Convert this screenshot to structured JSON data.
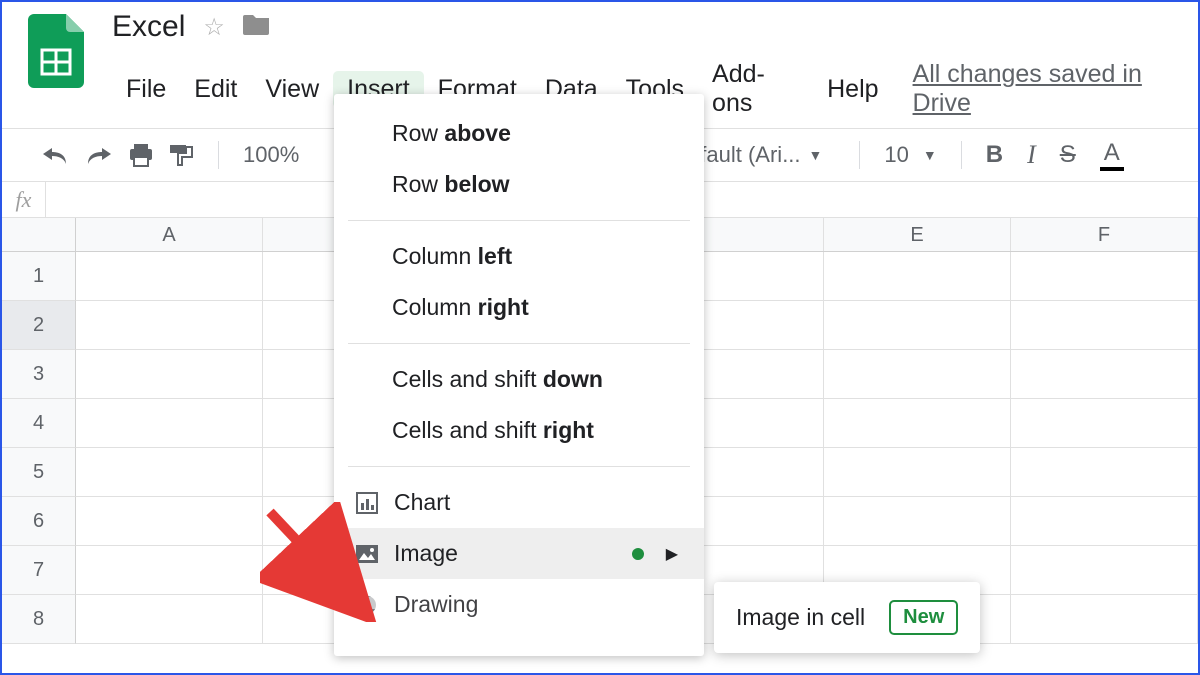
{
  "doc_title": "Excel",
  "menubar": [
    "File",
    "Edit",
    "View",
    "Insert",
    "Format",
    "Data",
    "Tools",
    "Add-ons",
    "Help"
  ],
  "active_menu_index": 3,
  "save_status": "All changes saved in Drive",
  "toolbar": {
    "zoom": "100%",
    "font_label": "fault (Ari...",
    "font_size": "10"
  },
  "columns": [
    "A",
    "",
    "",
    "",
    "E",
    "F"
  ],
  "row_count": 8,
  "selected_row": 2,
  "dropdown": {
    "group1": [
      {
        "prefix": "Row ",
        "bold": "above"
      },
      {
        "prefix": "Row ",
        "bold": "below"
      }
    ],
    "group2": [
      {
        "prefix": "Column ",
        "bold": "left"
      },
      {
        "prefix": "Column ",
        "bold": "right"
      }
    ],
    "group3": [
      {
        "prefix": "Cells and shift ",
        "bold": "down"
      },
      {
        "prefix": "Cells and shift ",
        "bold": "right"
      }
    ],
    "group4": [
      {
        "label": "Chart",
        "icon": "chart",
        "hover": false
      },
      {
        "label": "Image",
        "icon": "image",
        "hover": true,
        "dot": true,
        "arrow": true
      },
      {
        "label": "Drawing",
        "icon": "drawing",
        "hover": false
      }
    ]
  },
  "submenu": {
    "label": "Image in cell",
    "badge": "New"
  }
}
